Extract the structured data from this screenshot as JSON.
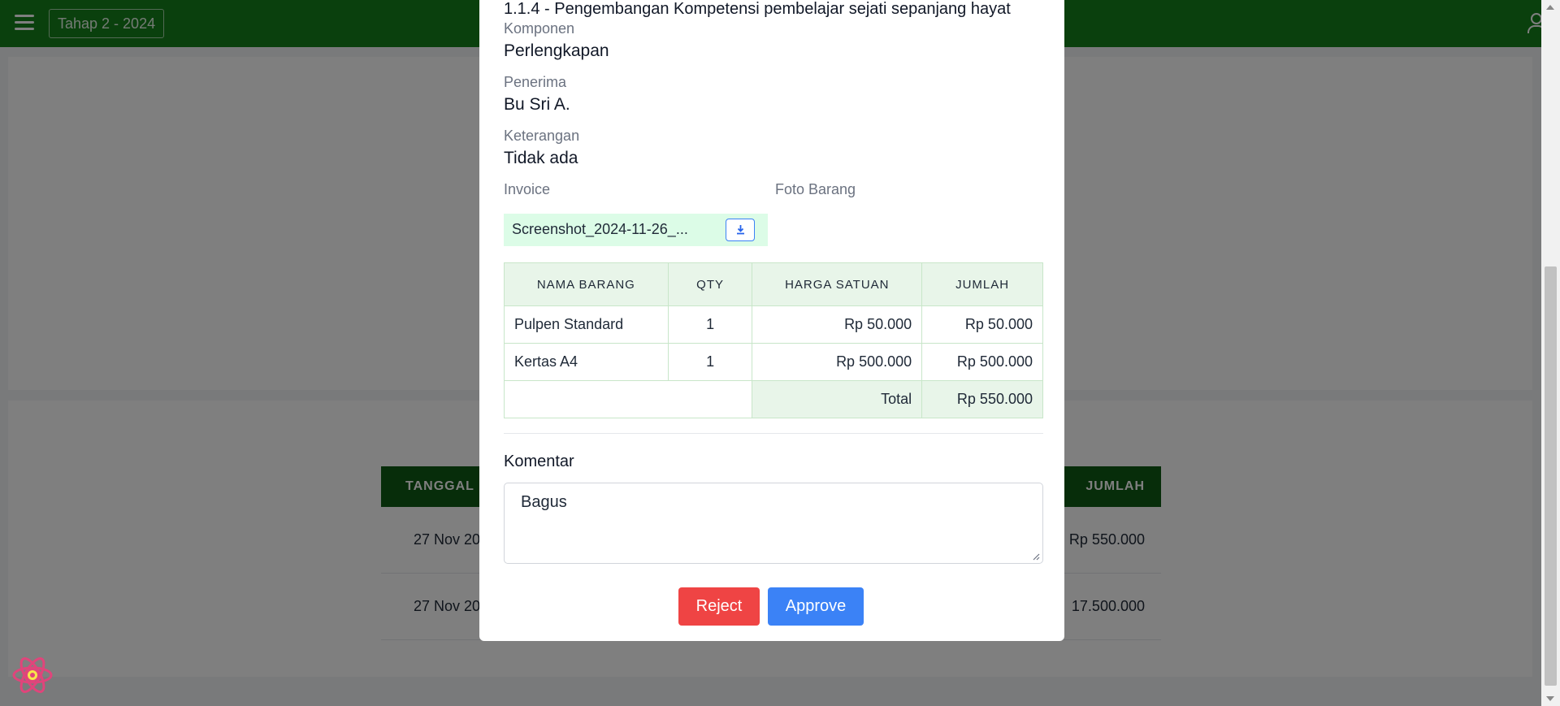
{
  "topbar": {
    "period": "Tahap 2 - 2024"
  },
  "background_table": {
    "headers": [
      "TANGGAL IN",
      "JUMLAH"
    ],
    "rows": [
      {
        "tanggal": "27 Nov 20",
        "jumlah": "Rp 550.000"
      },
      {
        "tanggal": "27 Nov 20",
        "jumlah": "17.500.000"
      }
    ]
  },
  "modal": {
    "title": "1.1.4 - Pengembangan Kompetensi pembelajar sejati sepanjang hayat",
    "komponen_label": "Komponen",
    "komponen_value": "Perlengkapan",
    "penerima_label": "Penerima",
    "penerima_value": "Bu Sri A.",
    "keterangan_label": "Keterangan",
    "keterangan_value": "Tidak ada",
    "invoice_label": "Invoice",
    "invoice_file": "Screenshot_2024-11-26_...",
    "foto_label": "Foto Barang",
    "table": {
      "headers": [
        "NAMA BARANG",
        "QTY",
        "HARGA SATUAN",
        "JUMLAH"
      ],
      "rows": [
        {
          "nama": "Pulpen Standard",
          "qty": "1",
          "harga": "Rp 50.000",
          "jumlah": "Rp 50.000"
        },
        {
          "nama": "Kertas A4",
          "qty": "1",
          "harga": "Rp 500.000",
          "jumlah": "Rp 500.000"
        }
      ],
      "total_label": "Total",
      "total_value": "Rp 550.000"
    },
    "komentar_label": "Komentar",
    "komentar_value": "Bagus",
    "reject_label": "Reject",
    "approve_label": "Approve"
  },
  "colors": {
    "topbar": "#15801b",
    "reject": "#ef4444",
    "approve": "#3b82f6",
    "table_header": "#e8f5e9"
  }
}
